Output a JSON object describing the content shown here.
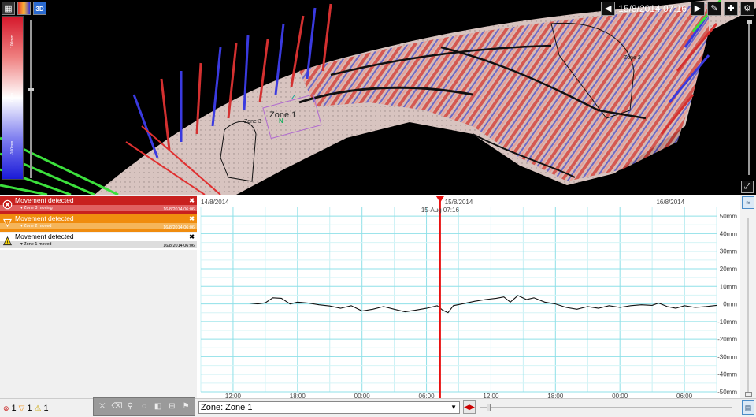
{
  "toolbar": {
    "icons": [
      "layers-toggle-icon",
      "colormap-icon",
      "3d-view-icon"
    ],
    "labels": [
      "",
      "",
      "3D"
    ]
  },
  "navigation": {
    "datetime": "15/8/2014 07:16",
    "prev": "◀",
    "next": "▶",
    "edit": "✎",
    "add": "✚",
    "settings": "⚙"
  },
  "colorscale": {
    "top_label": "100mm",
    "mid_label": "0mm",
    "bottom_label": "-100mm",
    "colors": {
      "positive": "#d5182b",
      "neutral": "#ffffff",
      "negative": "#1a1ad8"
    }
  },
  "map": {
    "zone_labels": [
      "Zone 1",
      "Zone 2",
      "Zone 3"
    ],
    "axis_marker_z": "Z",
    "axis_marker_n": "N"
  },
  "alerts": [
    {
      "title": "Movement detected",
      "subtitle": "Zone 3 moving",
      "time": "16/8/2014 06:06",
      "level": "red"
    },
    {
      "title": "Movement detected",
      "subtitle": "Zone 2 moved",
      "time": "16/8/2014 06:06",
      "level": "orange"
    },
    {
      "title": "Movement detected",
      "subtitle": "Zone 1 moved",
      "time": "16/8/2014 06:06",
      "level": "white"
    }
  ],
  "alert_close": "✖",
  "status_counts": {
    "red": "1",
    "orange": "1",
    "yellow": "1"
  },
  "zone_selector": {
    "value": "Zone: Zone 1"
  },
  "chart_data": {
    "type": "line",
    "date_labels": [
      "14/8/2014",
      "15/8/2014",
      "16/8/2014"
    ],
    "x_tick_labels": [
      "12:00",
      "18:00",
      "00:00",
      "06:00",
      "12:00",
      "18:00",
      "00:00",
      "06:00"
    ],
    "y_tick_labels": [
      "50mm",
      "40mm",
      "30mm",
      "20mm",
      "10mm",
      "0mm",
      "-10mm",
      "-20mm",
      "-30mm",
      "-40mm",
      "-50mm"
    ],
    "ylim": [
      -50,
      55
    ],
    "xlim_hours": [
      "14/8/2014 09:00",
      "16/8/2014 09:00"
    ],
    "cursor_label": "15-Aug 07:16",
    "cursor_hour": 22.27,
    "grid": true,
    "series": [
      {
        "values": [
          [
            4.5,
            0.5
          ],
          [
            5.3,
            0.0
          ],
          [
            6.0,
            0.6
          ],
          [
            6.7,
            3.5
          ],
          [
            7.5,
            3.2
          ],
          [
            8.3,
            0.0
          ],
          [
            9.0,
            1.0
          ],
          [
            10.0,
            0.5
          ],
          [
            11.0,
            -0.5
          ],
          [
            12.0,
            -1.2
          ],
          [
            13.0,
            -2.5
          ],
          [
            14.0,
            -1.0
          ],
          [
            15.0,
            -4.0
          ],
          [
            16.0,
            -3.0
          ],
          [
            17.0,
            -1.5
          ],
          [
            18.0,
            -3.0
          ],
          [
            19.0,
            -4.5
          ],
          [
            20.0,
            -3.5
          ],
          [
            21.0,
            -2.5
          ],
          [
            22.0,
            -1.0
          ],
          [
            22.5,
            -3.5
          ],
          [
            23.0,
            -5.0
          ],
          [
            23.5,
            -1.0
          ],
          [
            24.5,
            0.2
          ],
          [
            25.5,
            1.5
          ],
          [
            26.5,
            2.5
          ],
          [
            27.5,
            3.2
          ],
          [
            28.2,
            4.0
          ],
          [
            28.8,
            1.0
          ],
          [
            29.5,
            4.8
          ],
          [
            30.3,
            2.5
          ],
          [
            31.0,
            3.5
          ],
          [
            32.0,
            1.0
          ],
          [
            33.0,
            0.0
          ],
          [
            34.0,
            -2.0
          ],
          [
            35.0,
            -3.0
          ],
          [
            36.0,
            -1.5
          ],
          [
            37.0,
            -2.5
          ],
          [
            38.0,
            -1.0
          ],
          [
            39.0,
            -2.0
          ],
          [
            40.0,
            -1.0
          ],
          [
            41.0,
            -0.5
          ],
          [
            42.0,
            -0.8
          ],
          [
            42.6,
            0.5
          ],
          [
            43.4,
            -1.5
          ],
          [
            44.2,
            -2.5
          ],
          [
            45.0,
            -1.0
          ],
          [
            46.0,
            -2.0
          ],
          [
            47.0,
            -1.5
          ],
          [
            48.0,
            -0.8
          ]
        ]
      }
    ]
  }
}
